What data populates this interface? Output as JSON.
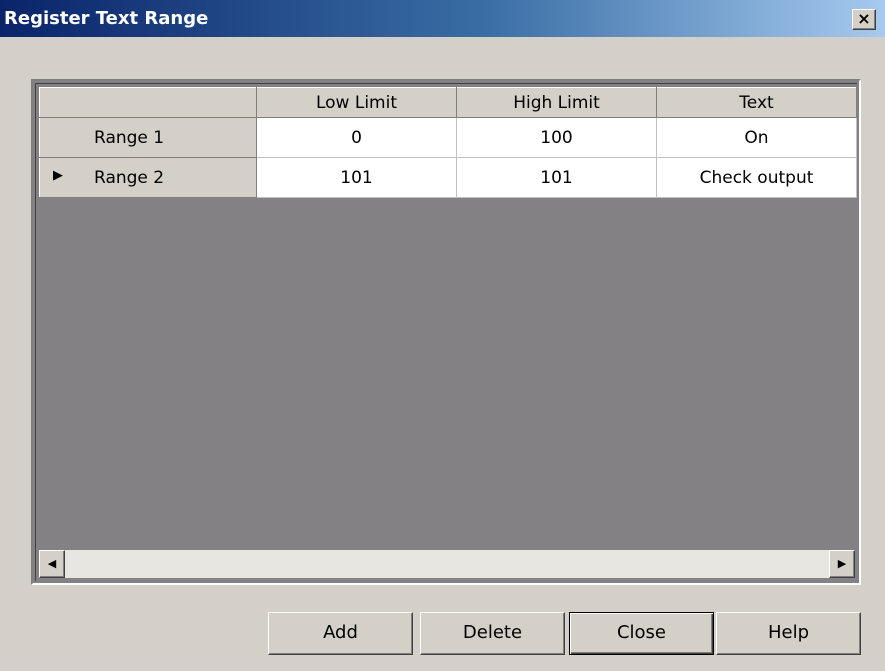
{
  "window": {
    "title": "Register Text Range",
    "close_glyph": "×"
  },
  "grid": {
    "columns": [
      "Low Limit",
      "High Limit",
      "Text"
    ],
    "rows": [
      {
        "label": "Range 1",
        "low": "0",
        "high": "100",
        "text": "On",
        "current": false
      },
      {
        "label": "Range 2",
        "low": "101",
        "high": "101",
        "text": "Check output",
        "current": true
      }
    ],
    "row_pointer_glyph": "▶"
  },
  "scrollbar": {
    "left_glyph": "◀",
    "right_glyph": "▶"
  },
  "buttons": {
    "add": "Add",
    "delete": "Delete",
    "close": "Close",
    "help": "Help"
  },
  "colors": {
    "title_start": "#0a246a",
    "title_end": "#a6caf0",
    "grid_background": "#838183",
    "face": "#d4d0c8"
  }
}
